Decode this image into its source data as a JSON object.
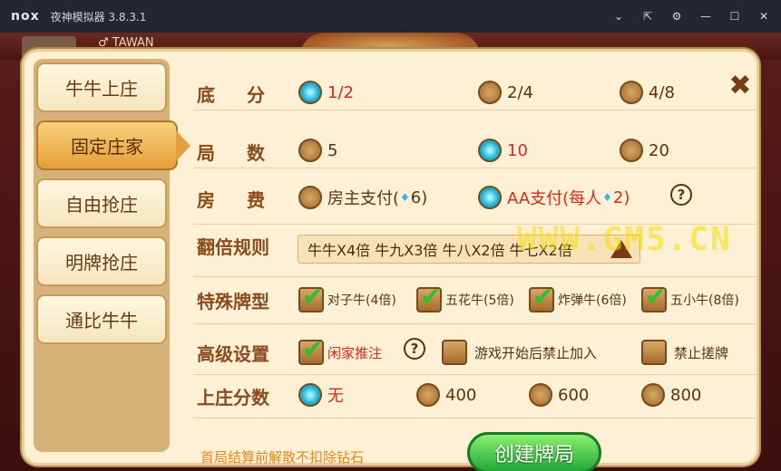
{
  "window": {
    "logo": "nox",
    "title": "夜神模拟器 3.8.3.1",
    "controls": [
      "chevron-down-icon",
      "pin-icon",
      "gear-icon",
      "minimize-icon",
      "maximize-icon",
      "close-icon"
    ]
  },
  "background": {
    "username": "♂ TAWAN"
  },
  "tabs": [
    {
      "label": "牛牛上庄",
      "active": false
    },
    {
      "label": "固定庄家",
      "active": true
    },
    {
      "label": "自由抢庄",
      "active": false
    },
    {
      "label": "明牌抢庄",
      "active": false
    },
    {
      "label": "通比牛牛",
      "active": false
    }
  ],
  "settings": {
    "base_score": {
      "label": "底 分",
      "options": [
        {
          "text": "1/2",
          "selected": true
        },
        {
          "text": "2/4",
          "selected": false
        },
        {
          "text": "4/8",
          "selected": false
        }
      ]
    },
    "rounds": {
      "label": "局 数",
      "options": [
        {
          "text": "5",
          "selected": false
        },
        {
          "text": "10",
          "selected": true
        },
        {
          "text": "20",
          "selected": false
        }
      ]
    },
    "room_fee": {
      "label": "房 费",
      "owner": {
        "text_a": "房主支付(",
        "gem": "♦",
        "text_b": "6)",
        "selected": false
      },
      "aa": {
        "text_a": "AA支付(每人",
        "gem": "♦",
        "text_b": "2)",
        "selected": true
      }
    },
    "multiplier": {
      "label": "翻倍规则",
      "value": "牛牛X4倍 牛九X3倍 牛八X2倍 牛七X2倍"
    },
    "special": {
      "label": "特殊牌型",
      "options": [
        {
          "text": "对子牛(4倍)",
          "checked": true
        },
        {
          "text": "五花牛(5倍)",
          "checked": true
        },
        {
          "text": "炸弹牛(6倍)",
          "checked": true
        },
        {
          "text": "五小牛(8倍)",
          "checked": true
        }
      ]
    },
    "advanced": {
      "label": "高级设置",
      "options": [
        {
          "text": "闲家推注",
          "checked": true
        },
        {
          "text": "游戏开始后禁止加入",
          "checked": false
        },
        {
          "text": "禁止搓牌",
          "checked": false
        }
      ]
    },
    "banker_score": {
      "label": "上庄分数",
      "options": [
        {
          "text": "无",
          "selected": true
        },
        {
          "text": "400",
          "selected": false
        },
        {
          "text": "600",
          "selected": false
        },
        {
          "text": "800",
          "selected": false
        }
      ]
    }
  },
  "footer_note": "首局结算前解散不扣除钻石",
  "create_button": "创建牌局",
  "watermark": "WWW.GM5.CN",
  "colors": {
    "accent_red": "#d8281c",
    "brown": "#8a4a1c",
    "green_button": "#22a83a"
  }
}
